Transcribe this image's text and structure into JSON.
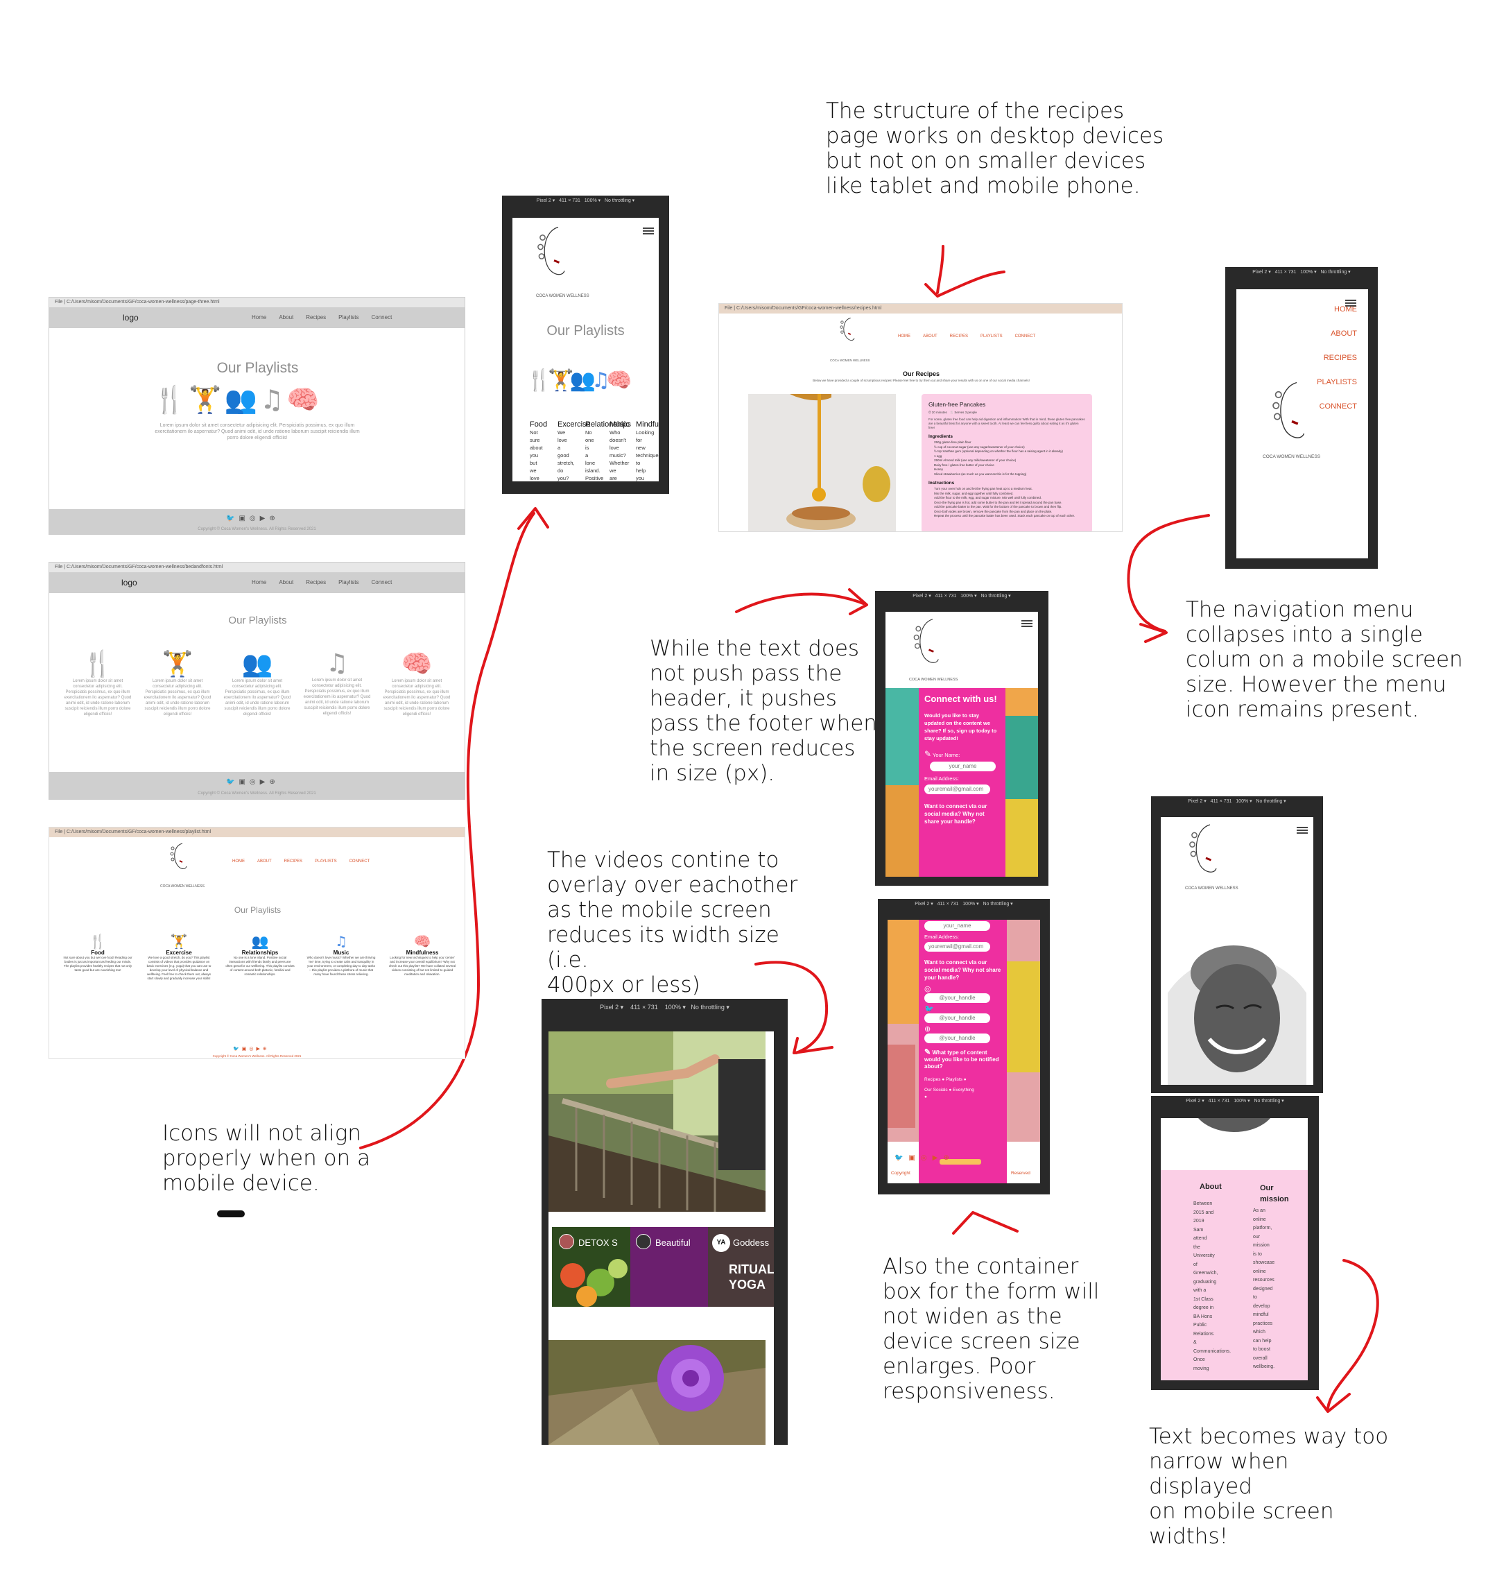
{
  "annotations": {
    "recipes_structure": "The structure of the recipes\npage works on desktop devices\nbut not on on smaller devices\nlike tablet and mobile phone.",
    "nav_collapse": "The navigation menu\ncollapses into a single\ncolum on a mobile screen\nsize. However the menu\nicon remains present.",
    "text_footer": "While the text does\nnot push pass the\nheader, it pushes\npass the footer when\nthe screen reduces\nin size (px).",
    "videos_overlay": "The videos contine to\noverlay over eachother\nas the mobile screen\nreduces its width size (i.e.\n400px or less)",
    "icons_align": "Icons will not align\nproperly when on a\nmobile device.",
    "form_container": "Also the container\nbox for the form will\nnot widen as the\ndevice screen size\nenlarges. Poor\nresponsiveness.",
    "text_narrow": "Text becomes way too\nnarrow when displayed\non mobile screen\nwidths!"
  },
  "desktop1": {
    "url": "File | C:/Users/misom/Documents/GF/coca-women-wellness/page-three.html",
    "logo": "logo",
    "nav": [
      "Home",
      "About",
      "Recipes",
      "Playlists",
      "Connect"
    ],
    "title": "Our Playlists",
    "lorem": "Lorem ipsum dolor sit amet consectetur adipisicing elit. Perspiciatis possimus, ex quo illum exercitationem ilo aspernatur? Quod animi odit, id unde ratione laborum suscipit reiciendis illum porro dolore eligendi officiis!",
    "copyright": "Copyright © Coca Women's Wellness. All Rights Reserved 2021"
  },
  "desktop2": {
    "url": "File | C:/Users/misom/Documents/GF/coca-women-wellness/bedandfonts.html",
    "logo": "logo",
    "nav": [
      "Home",
      "About",
      "Recipes",
      "Playlists",
      "Connect"
    ],
    "title": "Our Playlists",
    "lorem": "Lorem ipsum dolor sit amet consectetur adipisicing elit. Perspiciatis possimus, ex quo illum exercitationem ilo aspernatur? Quod animi odit, id unde ratione laborum suscipit reiciendis illum porro dolore eligendi officiis!",
    "copyright": "Copyright © Coca Women's Wellness. All Rights Reserved 2021"
  },
  "desktop3": {
    "url": "File | C:/Users/misom/Documents/GF/coca-women-wellness/playlist.html",
    "brand": "COCA WOMEN WELLNESS",
    "nav": [
      "HOME",
      "ABOUT",
      "RECIPES",
      "PLAYLISTS",
      "CONNECT"
    ],
    "title": "Our Playlists",
    "items": [
      {
        "name": "Food",
        "text": "Not sure about you but we love food! Reading our bodies is just as important as feeding our minds. The playlist provides healthy recipes that not only taste good but are nourishing too!"
      },
      {
        "name": "Excercise",
        "text": "We love a good stretch, do you? This playlist consists of videos that provides guidance on basic exercises (e.g. yoga) that you can use to develop your level of physical balance and wellbeing. Feel free to check them out, always start slowly and gradually increase your skills!"
      },
      {
        "name": "Relationships",
        "text": "No one is a lone island. Positive social interactions with friends family and peers are often great for our wellbeing. This playlist consists of content around both platonic, familial and romantic relationships."
      },
      {
        "name": "Music",
        "text": "Who doesn't love music? Whether we are thriving 'me' time, trying to create calm and tranquility in your environment, or completing day to day tasks – this playlist provides a plethora of music that many have found these stress relieving."
      },
      {
        "name": "Mindfulness",
        "text": "Looking for new techniques to help you 'centre' and increase your overall equilibrium? Why not check out this playlist? We have collated several videos consisting of but not limited to guided meditation and relaxation."
      }
    ],
    "copyright": "Copyright © Coca Women's Wellness. All Rights Reserved 2021"
  },
  "mobile_playlists": {
    "device": "Pixel 2 ▾",
    "width": "411",
    "height": "731",
    "zoom": "100% ▾",
    "throttle": "No throttling ▾",
    "brand": "COCA WOMEN WELLNESS",
    "title": "Our Playlists",
    "cols": [
      {
        "name": "Food",
        "words": [
          "Not",
          "sure",
          "about",
          "you",
          "but",
          "we",
          "love"
        ]
      },
      {
        "name": "Excercise",
        "words": [
          "We",
          "love",
          "a",
          "good",
          "stretch,",
          "do",
          "you?"
        ]
      },
      {
        "name": "Relationships",
        "words": [
          "No",
          "one",
          "is",
          "a",
          "lone",
          "island.",
          "Positive"
        ]
      },
      {
        "name": "Music",
        "words": [
          "Who",
          "doesn't",
          "love",
          "music?",
          "Whether",
          "we",
          "are"
        ]
      },
      {
        "name": "Mindfulness",
        "words": [
          "Looking",
          "for",
          "new",
          "techniques",
          "to",
          "help",
          "you"
        ]
      }
    ]
  },
  "recipes_desktop": {
    "url": "File | C:/Users/misom/Documents/GF/coca-women-wellness/recipes.html",
    "brand": "COCA WOMEN WELLNESS",
    "nav": [
      "HOME",
      "ABOUT",
      "RECIPES",
      "PLAYLISTS",
      "CONNECT"
    ],
    "title": "Our Recipes",
    "intro": "Below we have provided a couple of scrumptious recipes! Please feel free to try them out and share your results with us on one of our social media channels!",
    "recipe_title": "Gluten-free Pancakes",
    "meta_time": "20 minutes",
    "meta_serves": "Serves 3 people",
    "blurb": "For some, gluten free food can help aid digestion and inflammation! With that in mind, these gluten free pancakes are a beautiful treat for anyone with a sweet tooth. At least we can feel less guilty about eating it as it's gluten free!",
    "ingredients_h": "Ingredients",
    "ingredients": [
      "250g gluten-free plain flour",
      "½ cup of coconut sugar (use any sugar/sweetener of your choice)",
      "½ tsp Xanthan gum (optional depending on whether the flour has a raising agent in it already)",
      "1 egg",
      "250ml Almond milk (use any milk/sweetener of your choice)",
      "Dairy free / gluten-free butter of your choice",
      "Honey",
      "Sliced strawberries (as much as you want as this is for the topping)"
    ],
    "instructions_h": "Instructions",
    "instructions": [
      "Turn your oven hob on and let the frying pan heat up to a medium heat.",
      "Mix the milk, sugar, and egg together until fully combined.",
      "Add the flour to the milk, egg, and sugar mixture. Mix well until fully combined.",
      "Once the frying pan is hot, add some butter to the pan and let it spread around the pan base.",
      "Add the pancake batter to the pan. Wait for the bottom of the pancake to brown and then flip.",
      "Once both sides are brown, remove the pancake from the pan and place on the plate.",
      "Repeat the process until the pancake batter has been used. Stack each pancake on top of each other."
    ]
  },
  "mobile_nav": {
    "device": "Pixel 2 ▾",
    "width": "411",
    "height": "731",
    "zoom": "100% ▾",
    "throttle": "No throttling ▾",
    "links": [
      "HOME",
      "ABOUT",
      "RECIPES",
      "PLAYLISTS",
      "CONNECT"
    ],
    "brand": "COCA WOMEN WELLNESS"
  },
  "mobile_connect1": {
    "device": "Pixel 2 ▾",
    "width": "411",
    "height": "731",
    "zoom": "100% ▾",
    "throttle": "No throttling ▾",
    "brand": "COCA WOMEN WELLNESS",
    "heading": "Connect with us!",
    "lead": "Would you like to stay updated on the content we share? If so, sign up today to stay updated!",
    "name_label": "Your Name:",
    "name_ph": "your_name",
    "email_label": "Email Address:",
    "email_ph": "youremail@gmail.com",
    "social_q": "Want to connect via our social media? Why not share your handle?"
  },
  "mobile_connect2": {
    "device": "Pixel 2 ▾",
    "width": "411",
    "height": "731",
    "zoom": "100% ▾",
    "throttle": "No throttling ▾",
    "name_ph": "your_name",
    "email_label": "Email Address:",
    "email_ph": "youremail@gmail.com",
    "social_q": "Want to connect via our social media? Why not share your handle?",
    "handle1": "@your_handle",
    "handle2": "@your_handle",
    "handle3": "@your_handle",
    "content_q": "What type of content would you like to be notified about?",
    "opt_recipes": "Recipes",
    "opt_playlists": "Playlists",
    "opt_socials": "Our Socials",
    "opt_everything": "Everything",
    "copyright_left": "Copyright",
    "copyright_right": "Reserved"
  },
  "mobile_videos": {
    "device": "Pixel 2 ▾",
    "width": "411",
    "height": "731",
    "zoom": "100% ▾",
    "throttle": "No throttling ▾",
    "tiles": [
      "DETOX S",
      "Beautiful",
      "Goddess"
    ],
    "yt_badge": "YA",
    "yoga_text": "RITUAL YOGA"
  },
  "mobile_about_top": {
    "device": "Pixel 2 ▾",
    "width": "411",
    "height": "731",
    "zoom": "100% ▾",
    "throttle": "No throttling ▾",
    "brand": "COCA WOMEN WELLNESS"
  },
  "mobile_about": {
    "device": "Pixel 2 ▾",
    "width": "411",
    "height": "731",
    "zoom": "100% ▾",
    "throttle": "No throttling ▾",
    "about_h": "About",
    "mission_h": "Our mission",
    "about_words": [
      "Between",
      "2015 and",
      "2019",
      "Sam",
      "attend",
      "the",
      "University",
      "of",
      "Greenwich,",
      "graduating",
      "with a",
      "1st Class",
      "degree in",
      "BA Hons",
      "Public",
      "Relations",
      "&",
      "Communications.",
      "Once",
      "moving"
    ],
    "mission_words": [
      "As an",
      "online",
      "platform,",
      "our",
      "mission",
      "is to",
      "showcase",
      "online",
      "resources",
      "designed",
      "to",
      "develop",
      "mindful",
      "practices",
      "which",
      "can help",
      "to boost",
      "overall",
      "wellbeing."
    ]
  }
}
